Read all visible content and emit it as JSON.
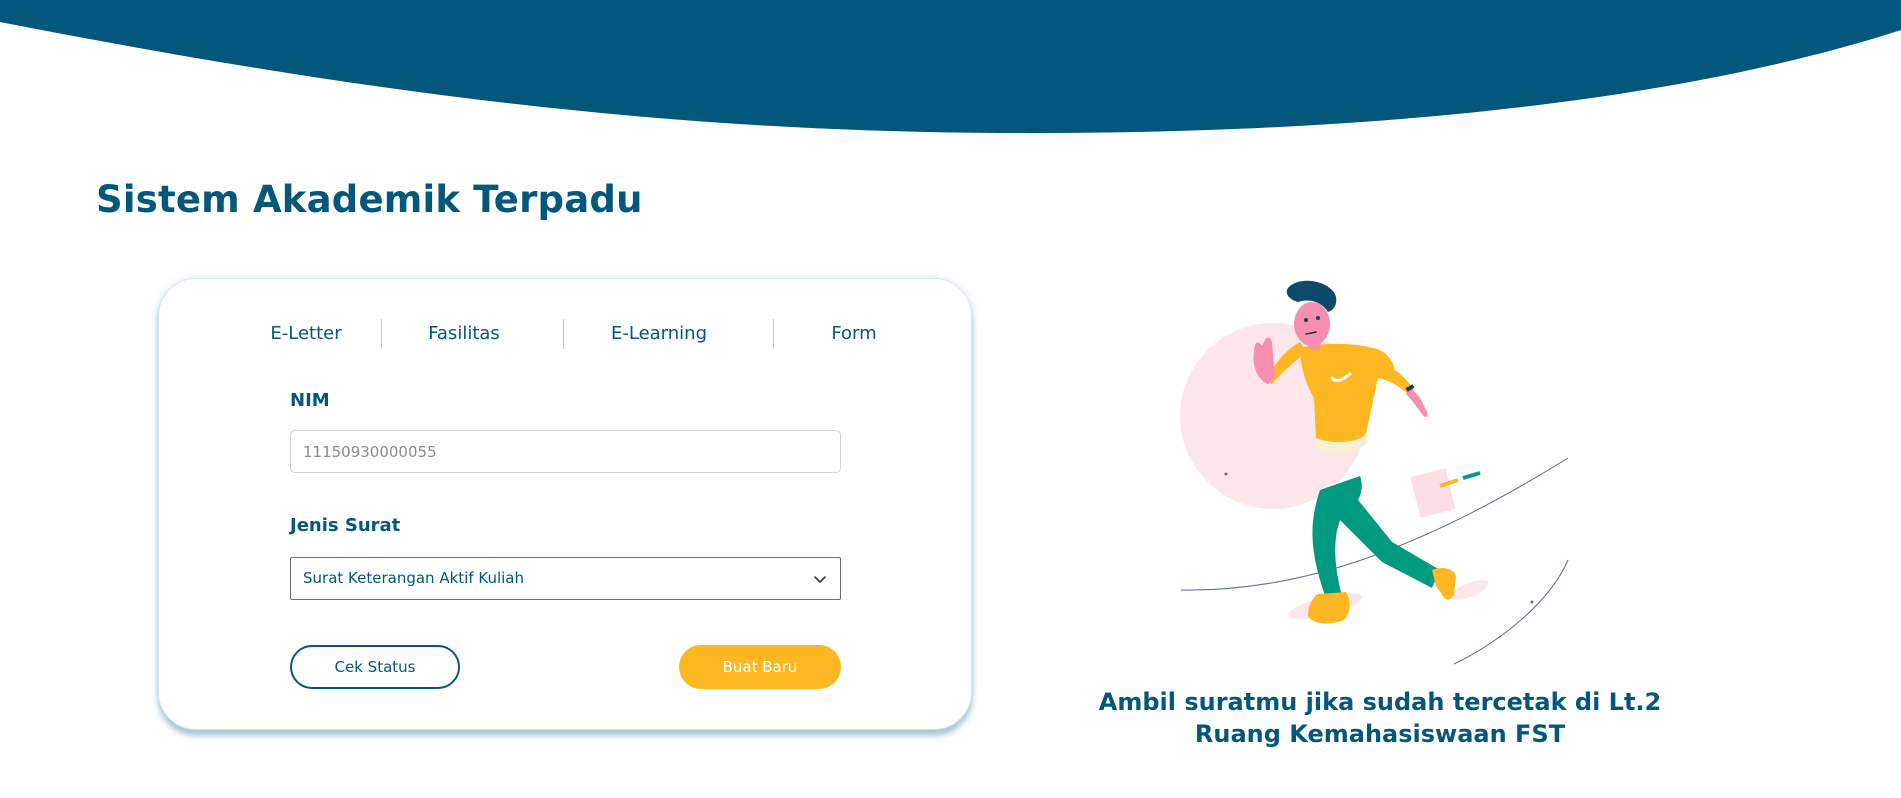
{
  "page": {
    "title": "Sistem Akademik Terpadu"
  },
  "tabs": [
    {
      "label": "E-Letter"
    },
    {
      "label": "Fasilitas"
    },
    {
      "label": "E-Learning"
    },
    {
      "label": "Form"
    }
  ],
  "form": {
    "nim_label": "NIM",
    "nim_value": "11150930000055",
    "jenis_label": "Jenis Surat",
    "jenis_selected": "Surat Keterangan Aktif Kuliah",
    "cek_status_label": "Cek Status",
    "buat_baru_label": "Buat Baru"
  },
  "caption": "Ambil suratmu jika sudah tercetak di Lt.2 Ruang Kemahasiswaan FST",
  "icons": {
    "select_arrow": "chevron-down-icon",
    "hero": "running-person-illustration"
  },
  "colors": {
    "brand_navy": "#03577a",
    "accent_yellow": "#fdb723",
    "accent_green": "#009a80",
    "accent_pink": "#f68eaf"
  }
}
